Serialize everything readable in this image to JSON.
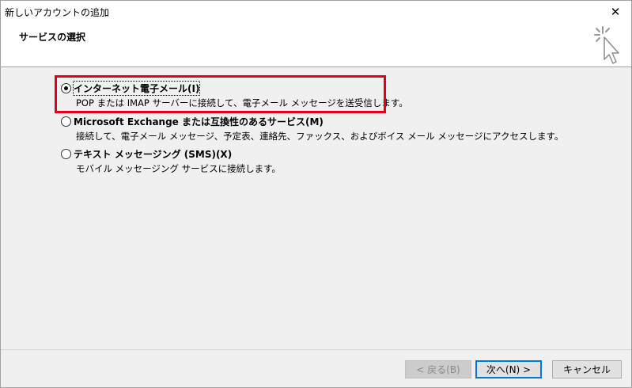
{
  "window": {
    "title": "新しいアカウントの追加",
    "close_glyph": "✕"
  },
  "header": {
    "title": "サービスの選択"
  },
  "options": [
    {
      "label": "インターネット電子メール(I)",
      "description": "POP または IMAP サーバーに接続して、電子メール メッセージを送受信します。",
      "selected": true
    },
    {
      "label": "Microsoft Exchange または互換性のあるサービス(M)",
      "description": "接続して、電子メール メッセージ、予定表、連絡先、ファックス、およびボイス メール メッセージにアクセスします。",
      "selected": false
    },
    {
      "label": "テキスト メッセージング (SMS)(X)",
      "description": "モバイル メッセージング サービスに接続します。",
      "selected": false
    }
  ],
  "buttons": {
    "back": "< 戻る(B)",
    "next": "次へ(N) >",
    "cancel": "キャンセル"
  },
  "colors": {
    "highlight": "#e60012",
    "accent": "#0078d7"
  }
}
